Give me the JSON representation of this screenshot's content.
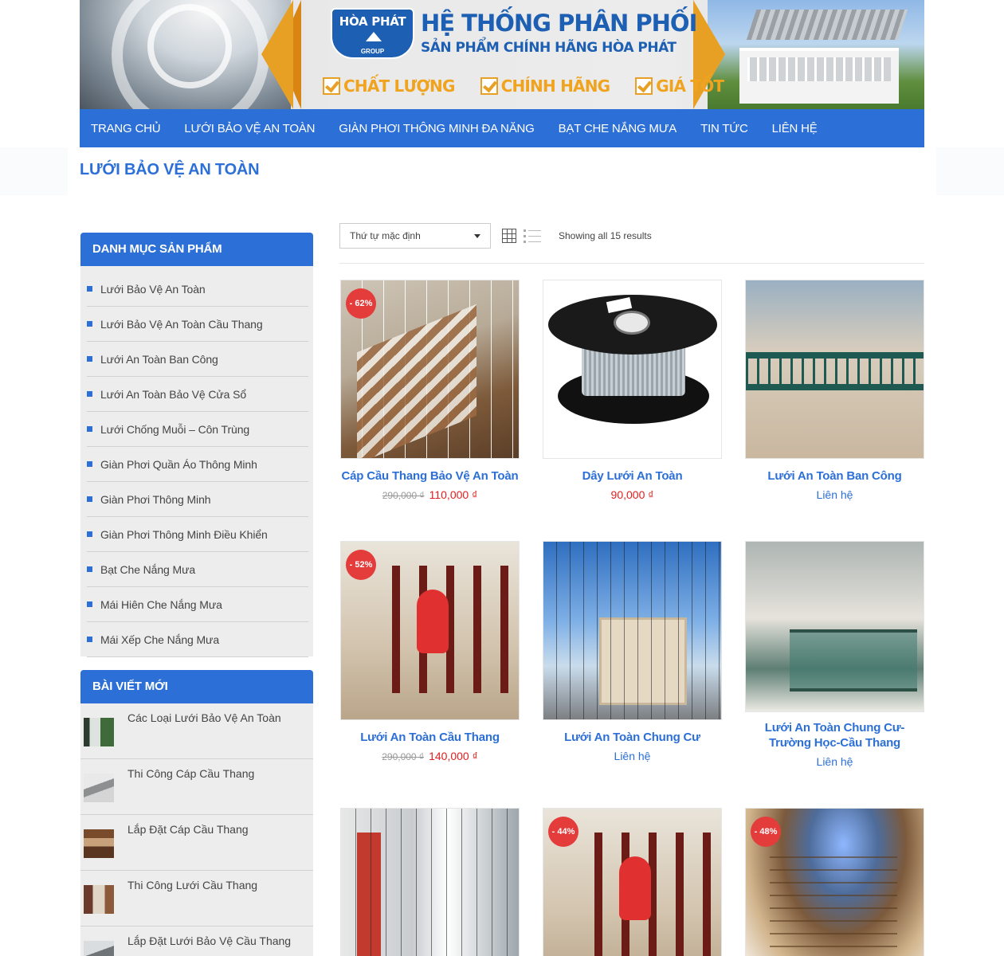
{
  "banner": {
    "logo_name": "HÒA PHÁT",
    "logo_group": "GROUP",
    "headline": "HỆ THỐNG PHÂN PHỐI",
    "subheadline": "SẢN PHẨM CHÍNH HÃNG HÒA PHÁT",
    "badges": [
      "CHẤT LƯỢNG",
      "CHÍNH HÃNG",
      "GIÁ TỐT"
    ]
  },
  "nav": {
    "items": [
      "TRANG CHỦ",
      "LƯỚI BẢO VỆ AN TOÀN",
      "GIÀN PHƠI THÔNG MINH ĐA NĂNG",
      "BẠT CHE NẮNG MƯA",
      "TIN TỨC",
      "LIÊN HỆ"
    ]
  },
  "page": {
    "title": "LƯỚI BẢO VỆ AN TOÀN"
  },
  "sidebar": {
    "categories_title": "DANH MỤC SẢN PHẨM",
    "categories": [
      "Lưới Bảo Vệ An Toàn",
      "Lưới Bảo Vệ An Toàn Cầu Thang",
      "Lưới An Toàn Ban Công",
      "Lưới An Toàn Bảo Vệ Cửa Sổ",
      "Lưới Chống Muỗi – Côn Trùng",
      "Giàn Phơi Quần Áo Thông Minh",
      "Giàn Phơi Thông Minh",
      "Giàn Phơi Thông Minh Điều Khiển",
      "Bạt Che Nắng Mưa",
      "Mái Hiên Che Nắng Mưa",
      "Mái Xếp Che Nắng Mưa"
    ],
    "posts_title": "BÀI VIẾT MỚI",
    "posts": [
      "Các Loại Lưới Bảo Vệ An Toàn",
      "Thi Công Cáp Cầu Thang",
      "Lắp Đặt Cáp Cầu Thang",
      "Thi Công Lưới Cầu Thang",
      "Lắp Đặt Lưới Bảo Vệ Cầu Thang"
    ]
  },
  "toolbar": {
    "sort_selected": "Thứ tự mặc định",
    "result_count": "Showing all 15 results"
  },
  "products": [
    {
      "name": "Cáp Cầu Thang Bảo Vệ An Toàn",
      "sale": "- 62%",
      "old_price": "290,000 ₫",
      "price": "110,000 ₫"
    },
    {
      "name": "Dây Lưới An Toàn",
      "price": "90,000 ₫"
    },
    {
      "name": "Lưới An Toàn Ban Công",
      "contact": "Liên hệ"
    },
    {
      "name": "Lưới An Toàn Cầu Thang",
      "sale": "- 52%",
      "old_price": "290,000 ₫",
      "price": "140,000 ₫"
    },
    {
      "name": "Lưới An Toàn Chung Cư",
      "contact": "Liên hệ"
    },
    {
      "name": "Lưới An Toàn Chung Cư-Trường Học-Cầu Thang",
      "contact": "Liên hệ"
    },
    {
      "name": ""
    },
    {
      "name": "",
      "sale": "- 44%"
    },
    {
      "name": "",
      "sale": "- 48%"
    }
  ],
  "colors": {
    "accent": "#2c6fd6",
    "sale": "#e43b3b",
    "price": "#e02020",
    "badge": "#f0a31e"
  }
}
